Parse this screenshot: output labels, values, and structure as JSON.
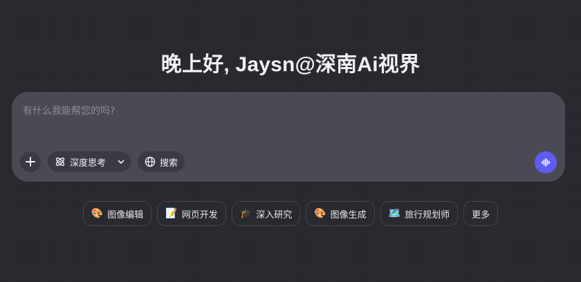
{
  "greeting": "晚上好, Jaysn@深南Ai视界",
  "composer": {
    "placeholder": "有什么我能帮您的吗?",
    "deep_think_label": "深度思考",
    "search_label": "搜索"
  },
  "chips": [
    {
      "emoji": "🎨",
      "label": "图像编辑"
    },
    {
      "emoji": "📝",
      "label": "网页开发"
    },
    {
      "emoji": "🎓",
      "label": "深入研究"
    },
    {
      "emoji": "🎨",
      "label": "图像生成"
    },
    {
      "emoji": "🗺️",
      "label": "旅行规划师"
    },
    {
      "emoji": "",
      "label": "更多"
    }
  ],
  "colors": {
    "background": "#26262d",
    "composer_bg": "#4a4a55",
    "accent": "#5d5bf0"
  }
}
